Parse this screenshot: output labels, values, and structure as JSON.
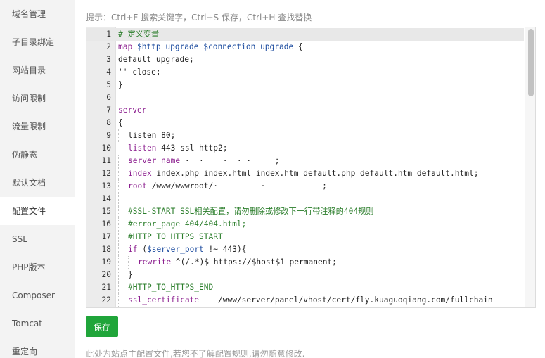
{
  "sidebar": {
    "items": [
      {
        "label": "域名管理"
      },
      {
        "label": "子目录绑定"
      },
      {
        "label": "网站目录"
      },
      {
        "label": "访问限制"
      },
      {
        "label": "流量限制"
      },
      {
        "label": "伪静态"
      },
      {
        "label": "默认文档"
      },
      {
        "label": "配置文件",
        "active": true
      },
      {
        "label": "SSL"
      },
      {
        "label": "PHP版本"
      },
      {
        "label": "Composer"
      },
      {
        "label": "Tomcat"
      },
      {
        "label": "重定向"
      }
    ]
  },
  "editor": {
    "tip": "提示：Ctrl+F 搜索关键字，Ctrl+S 保存，Ctrl+H 查找替换",
    "active_line": 1,
    "lines": [
      {
        "n": "1",
        "indent": 0,
        "tokens": [
          {
            "t": "# 定义变量",
            "c": "comment"
          }
        ]
      },
      {
        "n": "2",
        "indent": 0,
        "tokens": [
          {
            "t": "map ",
            "c": "kw"
          },
          {
            "t": "$http_upgrade $connection_upgrade",
            "c": "var"
          },
          {
            "t": " {",
            "c": ""
          }
        ]
      },
      {
        "n": "3",
        "indent": 0,
        "tokens": [
          {
            "t": "default upgrade;",
            "c": ""
          }
        ]
      },
      {
        "n": "4",
        "indent": 0,
        "tokens": [
          {
            "t": "'' close;",
            "c": ""
          }
        ]
      },
      {
        "n": "5",
        "indent": 0,
        "tokens": [
          {
            "t": "}",
            "c": ""
          }
        ]
      },
      {
        "n": "6",
        "indent": 0,
        "tokens": []
      },
      {
        "n": "7",
        "indent": 0,
        "tokens": [
          {
            "t": "server",
            "c": "kw"
          }
        ]
      },
      {
        "n": "8",
        "indent": 0,
        "tokens": [
          {
            "t": "{",
            "c": ""
          }
        ]
      },
      {
        "n": "9",
        "indent": 1,
        "guide": true,
        "tokens": [
          {
            "t": "listen 80;",
            "c": ""
          }
        ]
      },
      {
        "n": "10",
        "indent": 1,
        "guide": false,
        "tokens": [
          {
            "t": "listen",
            "c": "kw"
          },
          {
            "t": " 443 ssl http2;",
            "c": ""
          }
        ]
      },
      {
        "n": "11",
        "indent": 1,
        "guide": true,
        "tokens": [
          {
            "t": "server_name",
            "c": "kw"
          },
          {
            "t": " ·  ·    ·  · ·     ;",
            "c": ""
          }
        ]
      },
      {
        "n": "12",
        "indent": 1,
        "guide": true,
        "tokens": [
          {
            "t": "index",
            "c": "kw"
          },
          {
            "t": " index.php index.html index.htm default.php default.htm default.html;",
            "c": ""
          }
        ]
      },
      {
        "n": "13",
        "indent": 1,
        "guide": true,
        "tokens": [
          {
            "t": "root",
            "c": "kw"
          },
          {
            "t": " /www/wwwroot/·         ·            ;",
            "c": ""
          }
        ]
      },
      {
        "n": "14",
        "indent": 1,
        "guide": true,
        "tokens": []
      },
      {
        "n": "15",
        "indent": 1,
        "guide": true,
        "tokens": [
          {
            "t": "#SSL-START SSL相关配置，请勿删除或修改下一行带注释的404规则",
            "c": "comment"
          }
        ]
      },
      {
        "n": "16",
        "indent": 1,
        "guide": true,
        "tokens": [
          {
            "t": "#error_page 404/404.html;",
            "c": "comment"
          }
        ]
      },
      {
        "n": "17",
        "indent": 1,
        "guide": true,
        "tokens": [
          {
            "t": "#HTTP_TO_HTTPS_START",
            "c": "comment"
          }
        ]
      },
      {
        "n": "18",
        "indent": 1,
        "guide": true,
        "tokens": [
          {
            "t": "if",
            "c": "kw"
          },
          {
            "t": " (",
            "c": ""
          },
          {
            "t": "$server_port",
            "c": "var"
          },
          {
            "t": " !~ 443){",
            "c": ""
          }
        ]
      },
      {
        "n": "19",
        "indent": 2,
        "guide": true,
        "tokens": [
          {
            "t": "rewrite",
            "c": "kw"
          },
          {
            "t": " ^(/.*)$ https://$host$1 permanent;",
            "c": ""
          }
        ]
      },
      {
        "n": "20",
        "indent": 1,
        "guide": true,
        "tokens": [
          {
            "t": "}",
            "c": ""
          }
        ]
      },
      {
        "n": "21",
        "indent": 1,
        "guide": true,
        "tokens": [
          {
            "t": "#HTTP_TO_HTTPS_END",
            "c": "comment"
          }
        ]
      },
      {
        "n": "22",
        "indent": 1,
        "guide": true,
        "tokens": [
          {
            "t": "ssl_certificate",
            "c": "kw"
          },
          {
            "t": "    /www/server/panel/vhost/cert/fly.kuaguoqiang.com/fullchain",
            "c": ""
          }
        ]
      }
    ]
  },
  "save_button": {
    "label": "保存"
  },
  "footer_note": "此处为站点主配置文件,若您不了解配置规则,请勿随意修改."
}
